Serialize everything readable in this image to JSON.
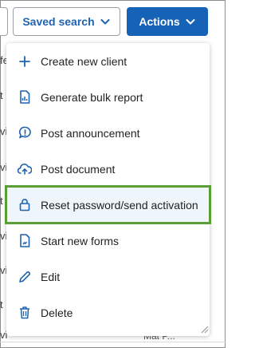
{
  "toolbar": {
    "saved_search_label": "Saved search",
    "actions_label": "Actions"
  },
  "background": {
    "fragments": [
      "fe",
      "t",
      "vi",
      "vi",
      "t",
      "vi",
      "vi",
      "t",
      "vi"
    ],
    "bottom_text": "Mat P..."
  },
  "menu": {
    "items": [
      {
        "label": "Create new client",
        "icon": "plus-icon"
      },
      {
        "label": "Generate bulk report",
        "icon": "report-icon"
      },
      {
        "label": "Post announcement",
        "icon": "announcement-icon"
      },
      {
        "label": "Post document",
        "icon": "cloud-upload-icon"
      },
      {
        "label": "Reset password/send activation",
        "icon": "lock-icon",
        "highlighted": true
      },
      {
        "label": "Start new forms",
        "icon": "forms-icon"
      },
      {
        "label": "Edit",
        "icon": "pencil-icon"
      },
      {
        "label": "Delete",
        "icon": "trash-icon"
      }
    ]
  },
  "colors": {
    "accent": "#1662b7",
    "link": "#1f63b0",
    "highlight_border": "#5a9e35",
    "highlight_bg": "#eef5fb"
  }
}
